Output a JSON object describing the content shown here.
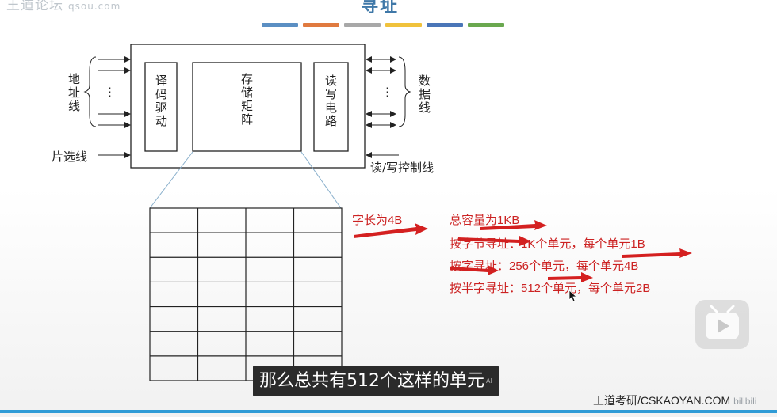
{
  "header": {
    "channel": "王道论坛",
    "channel_sub": "qsou.com",
    "slide_title": "寻址"
  },
  "title_bar_colors": [
    "#5b8fc3",
    "#e07a3f",
    "#a8a8a8",
    "#f0c23c",
    "#4a76b8",
    "#6aa84f"
  ],
  "diagram": {
    "address_line": "地址线",
    "chip_select": "片选线",
    "decoder": "译码驱动",
    "storage_matrix": "存储矩阵",
    "rw_circuit": "读写电路",
    "data_line": "数据线",
    "rw_control": "读/写控制线",
    "ellipsis": "⋮"
  },
  "grid": {
    "rows": 7,
    "cols": 4
  },
  "annotations": {
    "word_length": "字长为4B",
    "total_capacity": "总容量为1KB",
    "byte_addressing": "按字节寻址：1K个单元，每个单元1B",
    "word_addressing": "按字寻址：256个单元，每个单元4B",
    "halfword_addressing": "按半字寻址：512个单元，每个单元2B"
  },
  "subtitle": {
    "text": "那么总共有512个这样的单元",
    "ai_mark": "AI"
  },
  "brand": {
    "text": "王道考研/CSKAOYAN.COM",
    "watermark": "bilibili"
  },
  "colors": {
    "accent_red": "#d42020",
    "title_blue": "#3f78a8",
    "progress_blue": "#2f9bd6"
  }
}
